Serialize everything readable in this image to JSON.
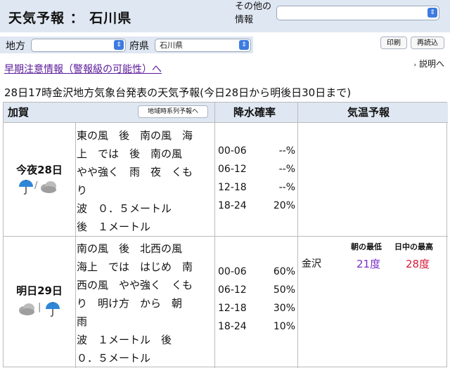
{
  "header": {
    "title": "天気予報 ： 石川県",
    "other_info_label": "その他の情報",
    "other_info_value": ""
  },
  "filters": {
    "region_label": "地方",
    "region_value": "",
    "prefecture_label": "府県",
    "prefecture_value": "石川県"
  },
  "actions": {
    "print_label": "印刷",
    "reload_label": "再読込"
  },
  "early_warning_link": "早期注意情報（警報級の可能性）へ",
  "explanation_link": "説明へ",
  "announcement": "28日17時金沢地方気象台発表の天気予報(今日28日から明後日30日まで)",
  "table": {
    "area": "加賀",
    "timeseries_button": "地域時系列予報へ",
    "precip_header": "降水確率",
    "temp_header": "気温予報",
    "rows": [
      {
        "day": "今夜28日",
        "weather_icon": "rain-then-cloudy-icon",
        "icon_sep": "/",
        "weather_lines": [
          "東の風　後　南の風　海",
          "上　では　後　南の風",
          "やや強く　雨　夜　くも",
          "り",
          "波　０．５メートル",
          "後　１メートル"
        ],
        "precip": [
          {
            "time": "00-06",
            "value": "--%"
          },
          {
            "time": "06-12",
            "value": "--%"
          },
          {
            "time": "12-18",
            "value": "--%"
          },
          {
            "time": "18-24",
            "value": "20%"
          }
        ]
      },
      {
        "day": "明日29日",
        "weather_icon": "cloudy-then-rain-icon",
        "icon_sep": "|",
        "weather_lines": [
          "南の風　後　北西の風",
          "海上　では　はじめ　南",
          "西の風　やや強く　くも",
          "り　明け方　から　朝",
          "雨",
          "波　１メートル　後",
          "０．５メートル"
        ],
        "precip": [
          {
            "time": "00-06",
            "value": "60%"
          },
          {
            "time": "06-12",
            "value": "50%"
          },
          {
            "time": "12-18",
            "value": "30%"
          },
          {
            "time": "18-24",
            "value": "10%"
          }
        ],
        "temp": {
          "min_header": "朝の最低",
          "max_header": "日中の最高",
          "city": "金沢",
          "min": "21度",
          "max": "28度"
        }
      }
    ]
  },
  "colors": {
    "header_bg": "#dfe7f2",
    "link": "#5b1a9a",
    "min_temp": "#7b2fc9",
    "max_temp": "#d81b3b"
  }
}
